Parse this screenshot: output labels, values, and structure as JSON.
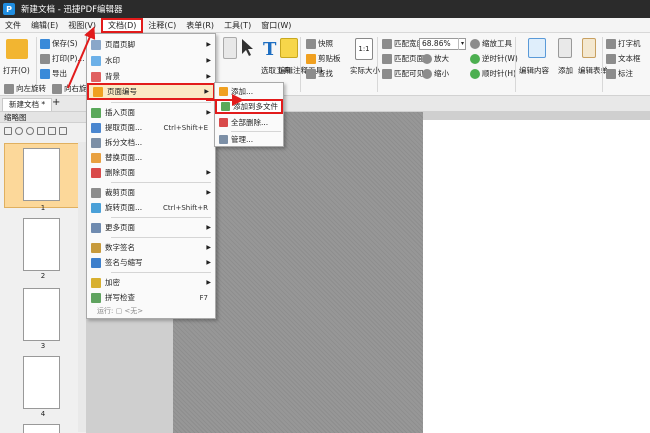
{
  "window": {
    "title": "新建文档 - 迅捷PDF编辑器"
  },
  "menubar": {
    "items": [
      "文件",
      "编辑(E)",
      "视图(V)",
      "文档(D)",
      "注释(C)",
      "表单(R)",
      "工具(T)",
      "窗口(W)"
    ]
  },
  "ribbon": {
    "open_label": "打开(O)",
    "save_label": "保存(S)",
    "print_label": "打印(P)...",
    "export_label": "导出",
    "select_tool_label": "选取工具",
    "edit_annot_label": "编辑注释工具",
    "snapshot_label": "快照",
    "clipboard_label": "剪贴板",
    "find_label": "查找",
    "actual_size_label": "实际大小",
    "fit_width_label": "匹配宽度",
    "fit_page_label": "匹配页面",
    "fit_visible_label": "匹配可见",
    "zoom_value": "68.86%",
    "zoom_in_label": "放大",
    "zoom_out_label": "缩小",
    "zoom_tool_label": "缩放工具",
    "ccw_label": "逆时针(W)",
    "cw_label": "顺时针(H)",
    "edit_content_label": "编辑内容",
    "add_label": "添加",
    "edit_form_label": "编辑表单",
    "typewriter_label": "打字机",
    "textbox_label": "文本框",
    "callout_label": "标注",
    "rotate_left_label": "向左旋转",
    "rotate_right_label": "向右旋转"
  },
  "tabs": {
    "doc_tab_label": "新建文档 *",
    "add_tab": "+"
  },
  "thumbnails": {
    "header": "缩略图",
    "pages": [
      "1",
      "2",
      "3",
      "4"
    ]
  },
  "dropdown": {
    "items": [
      {
        "label": "页眉页脚",
        "submenu": true
      },
      {
        "label": "水印",
        "submenu": true
      },
      {
        "label": "背景",
        "submenu": true
      },
      {
        "label": "页面编号",
        "submenu": true
      },
      {
        "label": "插入页面",
        "submenu": true
      },
      {
        "label": "提取页面...",
        "shortcut": "Ctrl+Shift+E"
      },
      {
        "label": "拆分文档..."
      },
      {
        "label": "替换页面..."
      },
      {
        "label": "删除页面",
        "submenu": true
      },
      {
        "label": "裁剪页面",
        "submenu": true
      },
      {
        "label": "旋转页面...",
        "shortcut": "Ctrl+Shift+R"
      },
      {
        "label": "更多页面",
        "submenu": true
      },
      {
        "label": "数字签名",
        "submenu": true
      },
      {
        "label": "签名与缩写",
        "submenu": true
      },
      {
        "label": "加密",
        "submenu": true
      },
      {
        "label": "拼写检查",
        "shortcut": "F7"
      }
    ],
    "footer": "运行: ▢ <无>"
  },
  "submenu": {
    "items": [
      "添加...",
      "添加到多文件",
      "全部删除...",
      "管理..."
    ]
  },
  "colors": {
    "highlight": "#e21b1b",
    "accent": "#3a8ad9",
    "selected_thumb": "#fcd89a"
  }
}
